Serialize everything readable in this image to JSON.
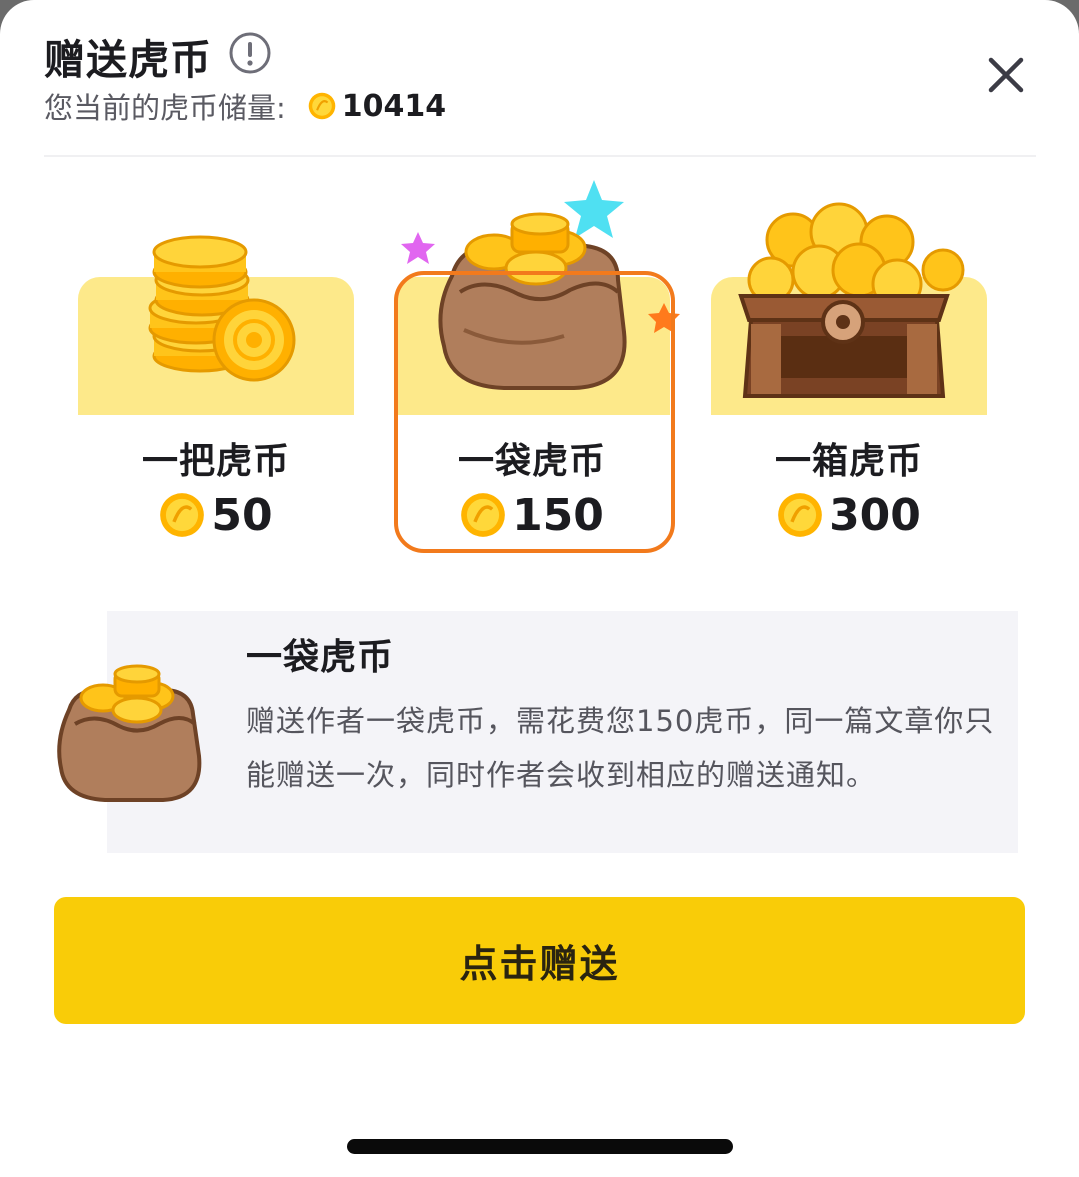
{
  "header": {
    "title": "赠送虎币",
    "info_icon": "info-circle-icon",
    "balance_label": "您当前的虎币储量:",
    "balance_value": "10414",
    "close_icon": "close-icon"
  },
  "options": [
    {
      "id": "handful",
      "name": "一把虎币",
      "price": "50",
      "art_icon": "coin-stack-icon",
      "selected": false
    },
    {
      "id": "bag",
      "name": "一袋虎币",
      "price": "150",
      "art_icon": "coin-bag-icon",
      "selected": true
    },
    {
      "id": "chest",
      "name": "一箱虎币",
      "price": "300",
      "art_icon": "treasure-chest-icon",
      "selected": false
    }
  ],
  "detail": {
    "title": "一袋虎币",
    "description": "赠送作者一袋虎币，需花费您150虎币，同一篇文章你只能赠送一次，同时作者会收到相应的赠送通知。"
  },
  "cta": {
    "label": "点击赠送"
  },
  "colors": {
    "accent_yellow": "#f9cc08",
    "card_bg": "#fde98a",
    "selected_border": "#f27a1c",
    "coin_gold": "#ffc81e",
    "bag_brown": "#b07e5c"
  }
}
